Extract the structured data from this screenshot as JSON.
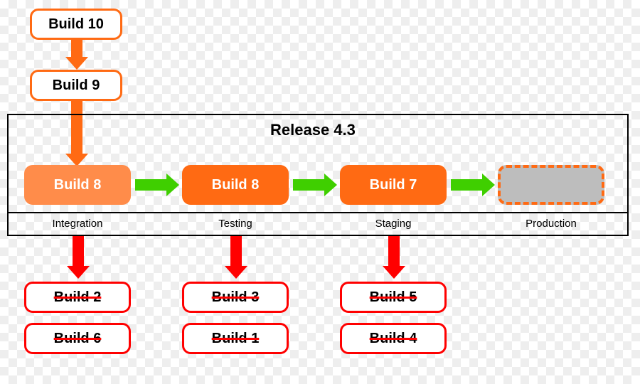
{
  "release": {
    "title": "Release 4.3"
  },
  "queue": [
    {
      "label": "Build 10"
    },
    {
      "label": "Build 9"
    }
  ],
  "stages": [
    {
      "name": "Integration",
      "build": "Build 8"
    },
    {
      "name": "Testing",
      "build": "Build 8"
    },
    {
      "name": "Staging",
      "build": "Build 7"
    },
    {
      "name": "Production",
      "build": null
    }
  ],
  "discarded": {
    "integration": [
      "Build 2",
      "Build 6"
    ],
    "testing": [
      "Build 3",
      "Build 1"
    ],
    "staging": [
      "Build 5",
      "Build 4"
    ]
  },
  "colors": {
    "orange": "#ff6a13",
    "green": "#3fcf00",
    "red": "#ff0000",
    "grey": "#bdbdbd"
  }
}
